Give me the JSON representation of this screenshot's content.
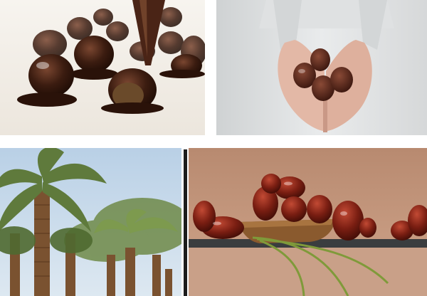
{
  "collage": {
    "tiles": [
      {
        "id": "chocolate-dipped-dates",
        "palette": {
          "bg": "#f3efe9",
          "chocolate": "#3b1c10",
          "highlight": "#7a4630"
        }
      },
      {
        "id": "hands-holding-dates",
        "palette": {
          "bg": "#e6e8e9",
          "skin": "#e3b8a6",
          "date": "#5a2a1e",
          "sweater": "#dfe1e2"
        }
      },
      {
        "id": "date-palm-grove",
        "palette": {
          "sky": "#c9dcec",
          "frond": "#5f7a3c",
          "trunk": "#7a5230"
        }
      },
      {
        "id": "dates-on-wooden-dish",
        "palette": {
          "bg": "#c79a7f",
          "date": "#7a1e12",
          "wood": "#8a5a2e",
          "slate": "#3a3d3f",
          "leaf": "#7f9a3a"
        }
      }
    ]
  }
}
